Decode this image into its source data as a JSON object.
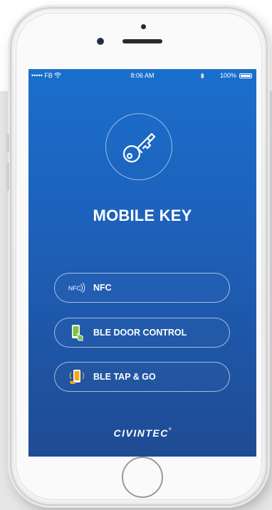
{
  "status_bar": {
    "carrier": "••••• FB",
    "time": "8:06 AM",
    "battery": "100%",
    "battery_level": 1.0
  },
  "app": {
    "title": "MOBILE KEY",
    "brand": "CIVINTEC",
    "brand_mark": "®"
  },
  "buttons": [
    {
      "label": "NFC",
      "icon": "nfc-icon"
    },
    {
      "label": "BLE DOOR CONTROL",
      "icon": "phone-touch-icon"
    },
    {
      "label": "BLE TAP & GO",
      "icon": "phone-tap-icon"
    }
  ],
  "colors": {
    "screen_top": "#1a6fcc",
    "screen_bottom": "#1f4b93",
    "icon_green": "#7bc242",
    "icon_orange": "#f5a623",
    "text": "#ffffff"
  }
}
